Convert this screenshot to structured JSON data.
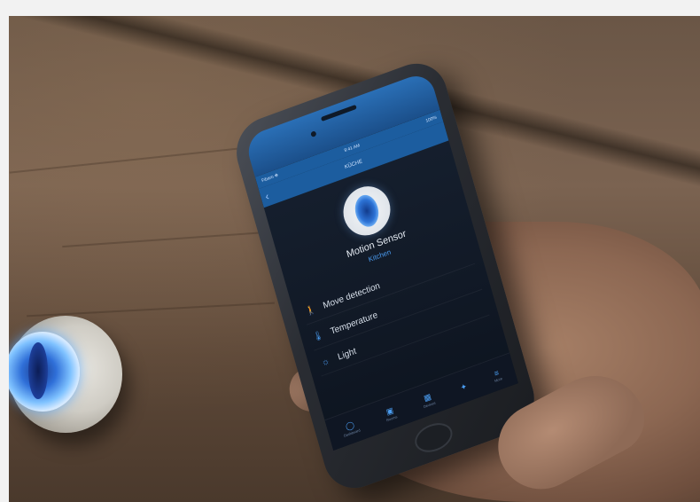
{
  "phone": {
    "status_carrier": "Fibaro ✻",
    "status_time": "9:41 AM",
    "status_battery": "100%",
    "nav_title": "KÜCHE",
    "device": {
      "name": "Motion Sensor",
      "room": "Kitchen"
    },
    "properties": [
      {
        "icon": "walk-icon",
        "label": "Move detection",
        "value": ""
      },
      {
        "icon": "thermometer-icon",
        "label": "Temperature",
        "value": ""
      },
      {
        "icon": "sun-icon",
        "label": "Light",
        "value": ""
      }
    ],
    "tabs": [
      {
        "icon": "dashboard-icon",
        "label": "Dashboard"
      },
      {
        "icon": "rooms-icon",
        "label": "Rooms"
      },
      {
        "icon": "devices-icon",
        "label": "Devices"
      },
      {
        "icon": "scenes-icon",
        "label": ""
      },
      {
        "icon": "more-icon",
        "label": "More"
      }
    ]
  },
  "colors": {
    "accent": "#4a9cf0",
    "header": "#1c5d9f",
    "screen_bg": "#111926"
  }
}
